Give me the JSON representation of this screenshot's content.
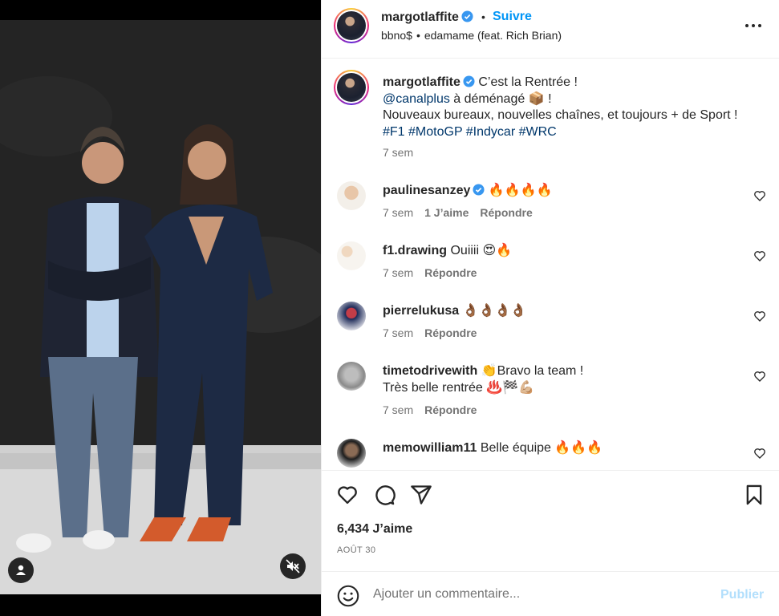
{
  "post": {
    "username": "margotlaffite",
    "verified": true,
    "follow_label": "Suivre",
    "separator": "•",
    "audio_artist": "bbno$",
    "audio_dot": "•",
    "audio_track": "edamame (feat. Rich Brian)",
    "more_icon": "more-horizontal-icon"
  },
  "caption": {
    "username": "margotlaffite",
    "line1": "C’est la Rentrée !",
    "mention": "@canalplus",
    "line2_rest": " à déménagé 📦 !",
    "line3": "Nouveaux bureaux, nouvelles chaînes, et toujours + de Sport !",
    "hashtags": [
      "#F1",
      "#MotoGP",
      "#Indycar",
      "#WRC"
    ],
    "time": "7 sem"
  },
  "comments": [
    {
      "username": "paulinesanzey",
      "verified": true,
      "text": "🔥🔥🔥🔥",
      "time": "7 sem",
      "likes": "1 J’aime",
      "reply": "Répondre"
    },
    {
      "username": "f1.drawing",
      "verified": false,
      "text": "Ouiiii 😍🔥",
      "time": "7 sem",
      "likes": "",
      "reply": "Répondre"
    },
    {
      "username": "pierrelukusa",
      "verified": false,
      "text": "👌🏾👌🏾👌🏾👌🏾",
      "time": "7 sem",
      "likes": "",
      "reply": "Répondre"
    },
    {
      "username": "timetodrivewith",
      "verified": false,
      "text": "👏Bravo la team !",
      "text2": "Très belle rentrée ♨️🏁💪🏼",
      "time": "7 sem",
      "likes": "",
      "reply": "Répondre"
    },
    {
      "username": "memowilliam11",
      "verified": false,
      "text": "Belle équipe 🔥🔥🔥",
      "time": "",
      "likes": "",
      "reply": ""
    }
  ],
  "stats": {
    "likes": "6,434 J’aime",
    "date": "AOÛT 30"
  },
  "composer": {
    "placeholder": "Ajouter un commentaire...",
    "publish_label": "Publier"
  },
  "colors": {
    "accent": "#0095f6",
    "verified": "#3897f0",
    "publish_disabled": "#b2dffc",
    "muted_text": "#737373"
  }
}
